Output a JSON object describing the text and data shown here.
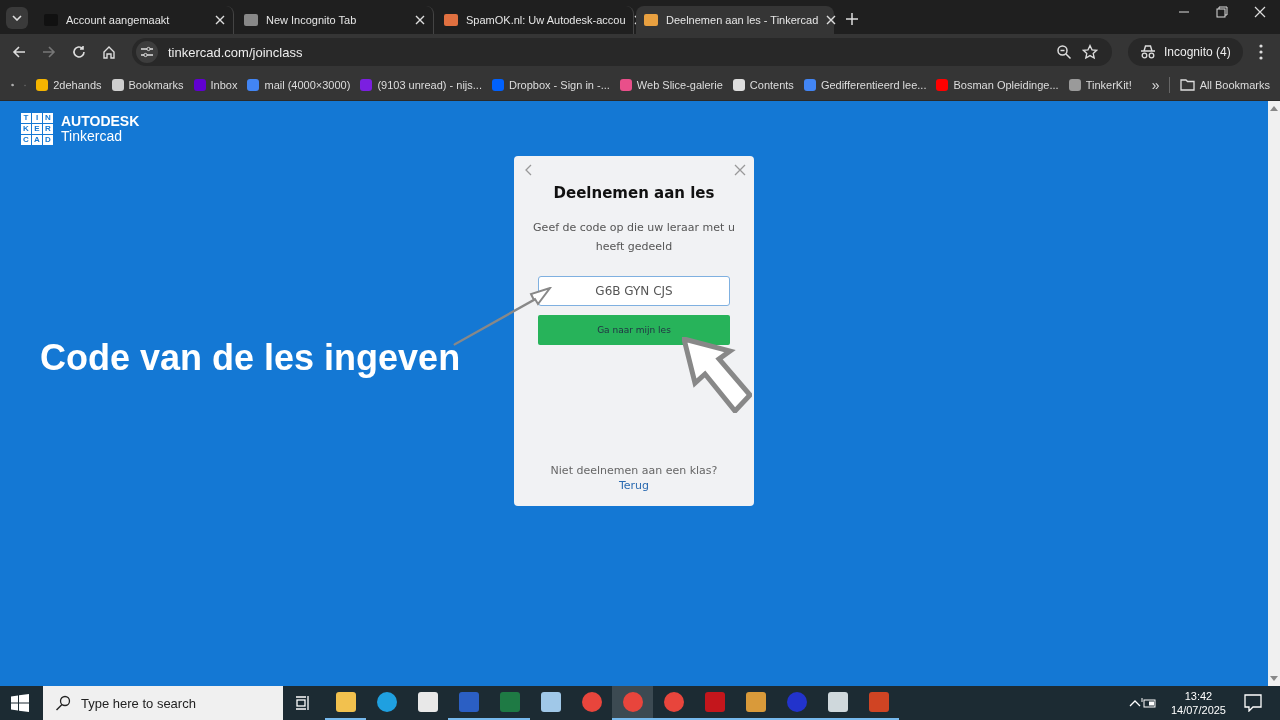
{
  "browser": {
    "tabs": [
      {
        "title": "Account aangemaakt",
        "selected": false
      },
      {
        "title": "New Incognito Tab",
        "selected": false
      },
      {
        "title": "SpamOK.nl: Uw Autodesk-accou",
        "selected": false
      },
      {
        "title": "Deelnemen aan les - Tinkercad",
        "selected": true
      }
    ],
    "url": "tinkercad.com/joinclass",
    "profile": "Incognito (4)",
    "bookmarks": [
      "2dehands",
      "Bookmarks",
      "Inbox",
      "mail (4000×3000)",
      "(9103 unread) - nijs...",
      "Dropbox - Sign in -...",
      "Web Slice-galerie",
      "Contents",
      "Gedifferentieerd lee...",
      "Bosman Opleidinge...",
      "TinkerKit!"
    ],
    "more_bookmarks": "»",
    "all_bookmarks": "All Bookmarks"
  },
  "page": {
    "logo": {
      "tiles": [
        "T",
        "I",
        "N",
        "K",
        "E",
        "R",
        "C",
        "A",
        "D"
      ],
      "brand": "AUTODESK",
      "product": "Tinkercad"
    },
    "annotation": "Code van de les ingeven",
    "dialog": {
      "title": "Deelnemen aan les",
      "description": "Geef de code op die uw leraar met u heeft gedeeld",
      "code": "G6B GYN CJS",
      "button": "Ga naar mijn les",
      "footer": "Niet deelnemen aan een klas?",
      "link": "Terug"
    }
  },
  "taskbar": {
    "search_placeholder": "Type here to search",
    "apps": [
      {
        "running": true,
        "selected": false
      },
      {
        "running": false,
        "selected": false
      },
      {
        "running": false,
        "selected": false
      },
      {
        "running": true,
        "selected": false
      },
      {
        "running": true,
        "selected": false
      },
      {
        "running": false,
        "selected": false
      },
      {
        "running": false,
        "selected": false
      },
      {
        "running": true,
        "selected": true
      },
      {
        "running": true,
        "selected": false
      },
      {
        "running": true,
        "selected": false
      },
      {
        "running": true,
        "selected": false
      },
      {
        "running": true,
        "selected": false
      },
      {
        "running": true,
        "selected": false
      },
      {
        "running": true,
        "selected": false
      }
    ],
    "time": "13:42",
    "date": "14/07/2025"
  }
}
